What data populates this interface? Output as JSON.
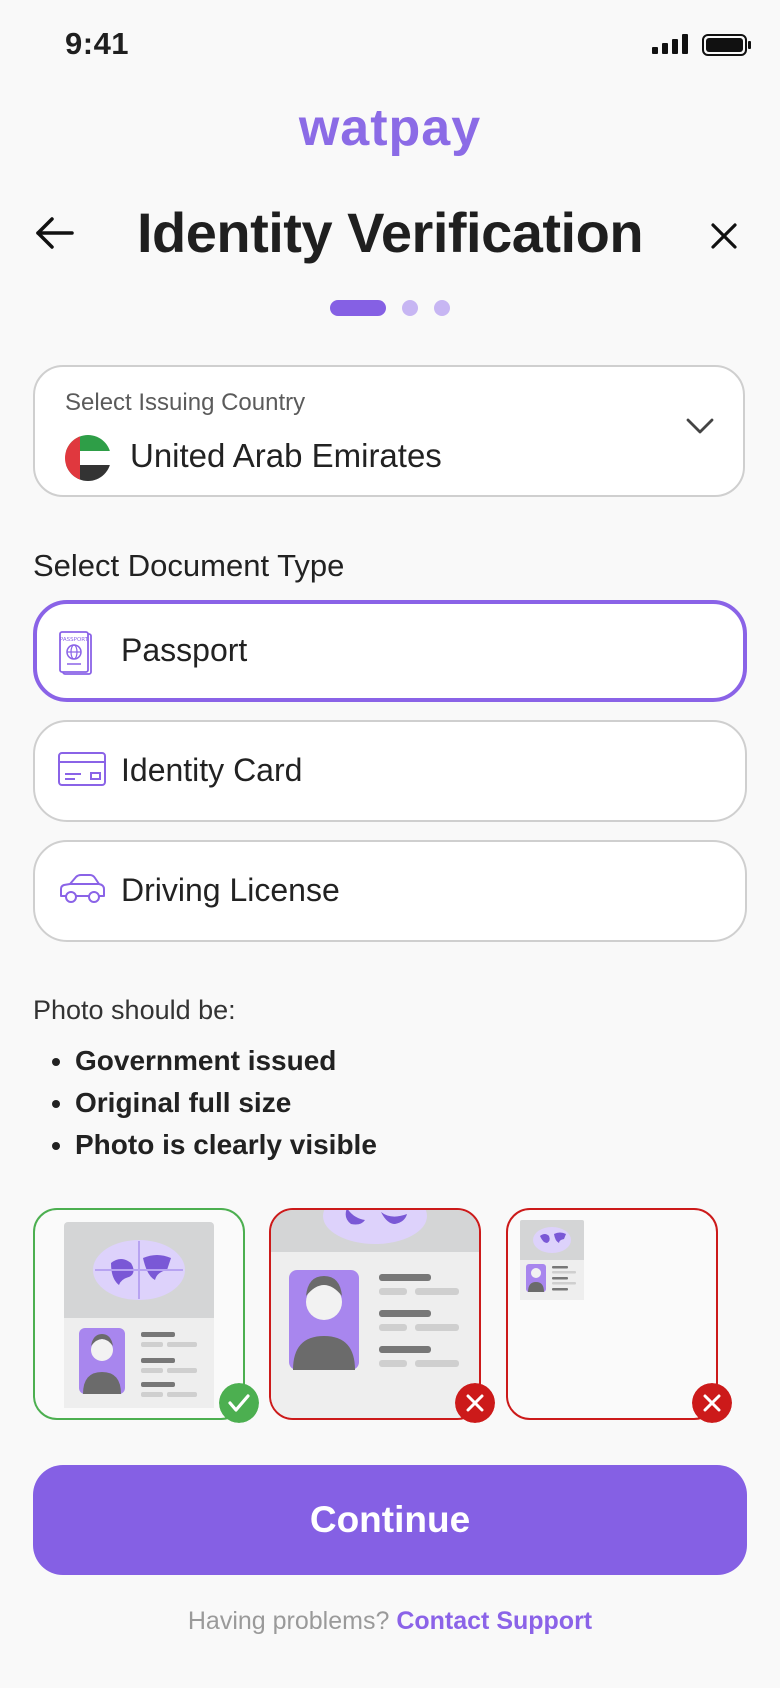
{
  "status_bar": {
    "time": "9:41",
    "signal_icon": "cellular-signal-icon",
    "battery_icon": "battery-icon"
  },
  "brand": {
    "logo_text": "watpay",
    "color": "#8b6be6"
  },
  "header": {
    "title": "Identity Verification",
    "back_icon": "arrow-left-icon",
    "close_icon": "close-icon"
  },
  "progress": {
    "total_steps": 3,
    "current_step": 1,
    "active_color": "#8560e4",
    "inactive_color": "#c7b6f3"
  },
  "country_select": {
    "label": "Select Issuing Country",
    "value": "United Arab Emirates",
    "flag_icon": "uae-flag-icon",
    "chevron_icon": "chevron-down-icon"
  },
  "document_type": {
    "label": "Select Document Type",
    "options": [
      {
        "label": "Passport",
        "icon": "passport-icon",
        "selected": true
      },
      {
        "label": "Identity Card",
        "icon": "identity-card-icon",
        "selected": false
      },
      {
        "label": "Driving License",
        "icon": "car-icon",
        "selected": false
      }
    ]
  },
  "photo_requirements": {
    "heading": "Photo should be:",
    "items": [
      "Government issued",
      "Original full size",
      "Photo is clearly visible"
    ]
  },
  "samples": [
    {
      "status": "valid",
      "icon": "check-badge-icon",
      "color": "#4caf50"
    },
    {
      "status": "invalid",
      "icon": "x-badge-icon",
      "color": "#cc1a1a"
    },
    {
      "status": "invalid",
      "icon": "x-badge-icon",
      "color": "#cc1a1a"
    }
  ],
  "actions": {
    "continue_label": "Continue"
  },
  "footer": {
    "help_text": "Having problems?",
    "support_link": "Contact Support"
  }
}
